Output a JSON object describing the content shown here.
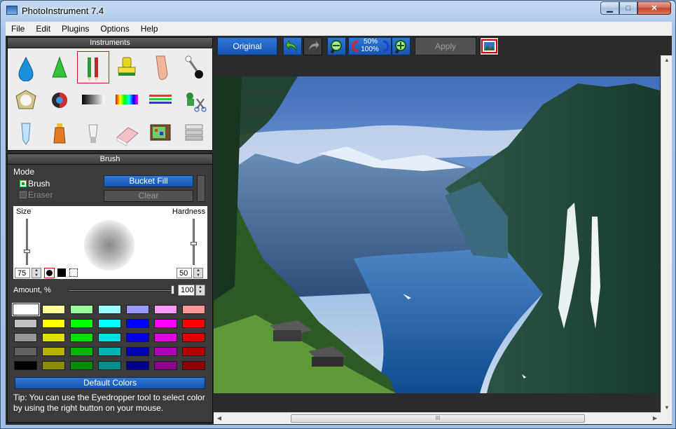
{
  "window": {
    "title": "PhotoInstrument 7.4"
  },
  "menu": [
    "File",
    "Edit",
    "Plugins",
    "Options",
    "Help"
  ],
  "toolbar": {
    "original": "Original",
    "zoom_percent_top": "50%",
    "zoom_percent_bottom": "100%",
    "apply": "Apply"
  },
  "instruments": {
    "title": "Instruments",
    "tools": [
      "blur-drop",
      "sharpen-cone",
      "brush-pencil",
      "stamp",
      "finger-smudge",
      "pin",
      "sun-brightness",
      "contrast-ball",
      "gradient-black",
      "color-spectrum",
      "color-lines",
      "plugins-scissors",
      "vial",
      "bottle",
      "light-bulb",
      "eraser",
      "tv-noise",
      "text-layers"
    ],
    "selected": "brush-pencil"
  },
  "brush": {
    "title": "Brush",
    "mode_label": "Mode",
    "brush_option": "Brush",
    "eraser_option": "Eraser",
    "bucket_fill": "Bucket Fill",
    "clear": "Clear",
    "size_label": "Size",
    "hardness_label": "Hardness",
    "size_value": "75",
    "hardness_value": "50",
    "amount_label": "Amount, %",
    "amount_value": "100",
    "default_colors": "Default Colors",
    "tip": "Tip: You can use the Eyedropper tool to select color by using the right button on your mouse."
  },
  "palette": [
    [
      "#ffffff",
      "#ffff99",
      "#99ff99",
      "#99ffff",
      "#9999ff",
      "#ff99ff",
      "#ff9999"
    ],
    [
      "#c0c0c0",
      "#ffff00",
      "#00ff00",
      "#00ffff",
      "#0000ff",
      "#ff00ff",
      "#ff0000"
    ],
    [
      "#969696",
      "#e0e000",
      "#00e000",
      "#00e0e0",
      "#0000e0",
      "#e000e0",
      "#e00000"
    ],
    [
      "#606060",
      "#b4b400",
      "#00b400",
      "#00b4b4",
      "#0000b4",
      "#b400b4",
      "#b40000"
    ],
    [
      "#000000",
      "#8c8c00",
      "#008c00",
      "#008c8c",
      "#00008c",
      "#8c008c",
      "#8c0000"
    ]
  ],
  "horizontal_scroll_grip": "III"
}
